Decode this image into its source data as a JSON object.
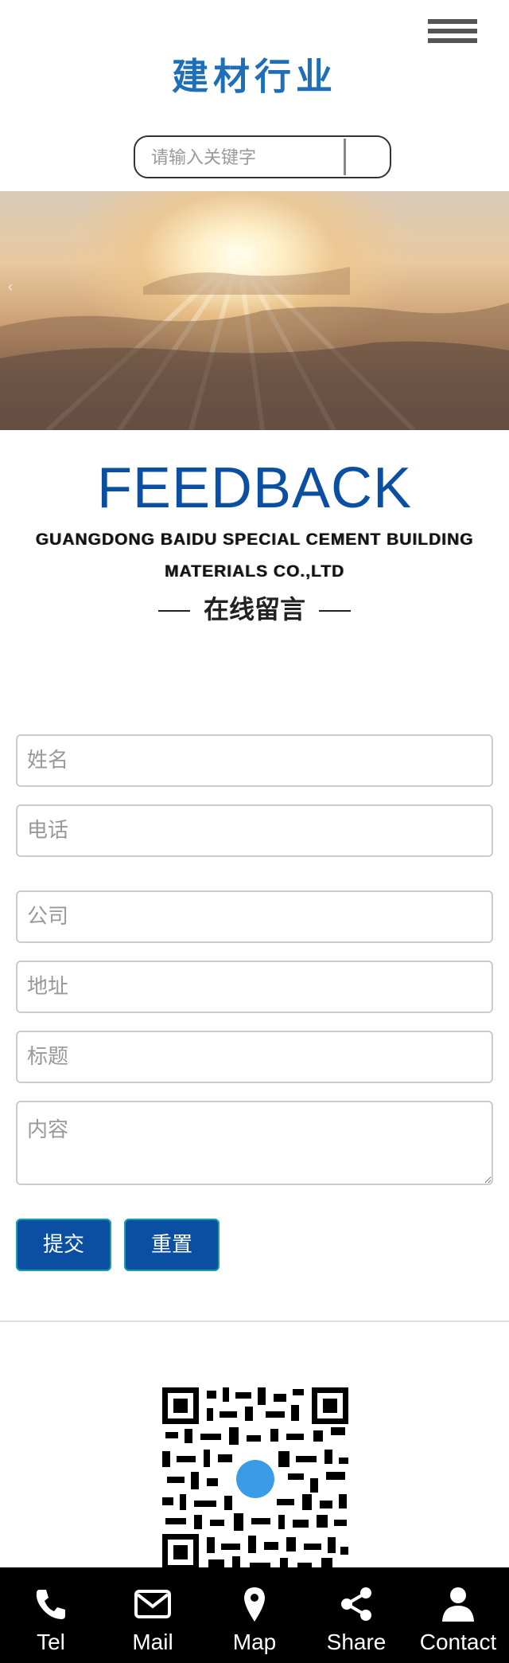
{
  "header": {
    "logo_text": "建材行业",
    "menu_icon": "hamburger-menu-icon"
  },
  "search": {
    "placeholder": "请输入关键字",
    "button_icon": "search-icon"
  },
  "feedback": {
    "title": "FEEDBACK",
    "company": "GUANGDONG BAIDU SPECIAL CEMENT BUILDING MATERIALS CO.,LTD",
    "subtitle_cn": "在线留言"
  },
  "form": {
    "name_placeholder": "姓名",
    "phone_placeholder": "电话",
    "company_placeholder": "公司",
    "address_placeholder": "地址",
    "subject_placeholder": "标题",
    "content_placeholder": "内容",
    "submit_label": "提交",
    "reset_label": "重置"
  },
  "colors": {
    "brand_blue": "#0b4fa3",
    "logo_blue": "#1f6fb8",
    "bottom_bar_bg": "#000000"
  },
  "bottom_nav": [
    {
      "label": "Tel",
      "icon": "phone-icon"
    },
    {
      "label": "Mail",
      "icon": "mail-icon"
    },
    {
      "label": "Map",
      "icon": "map-pin-icon"
    },
    {
      "label": "Share",
      "icon": "share-icon"
    },
    {
      "label": "Contact",
      "icon": "user-icon"
    }
  ]
}
